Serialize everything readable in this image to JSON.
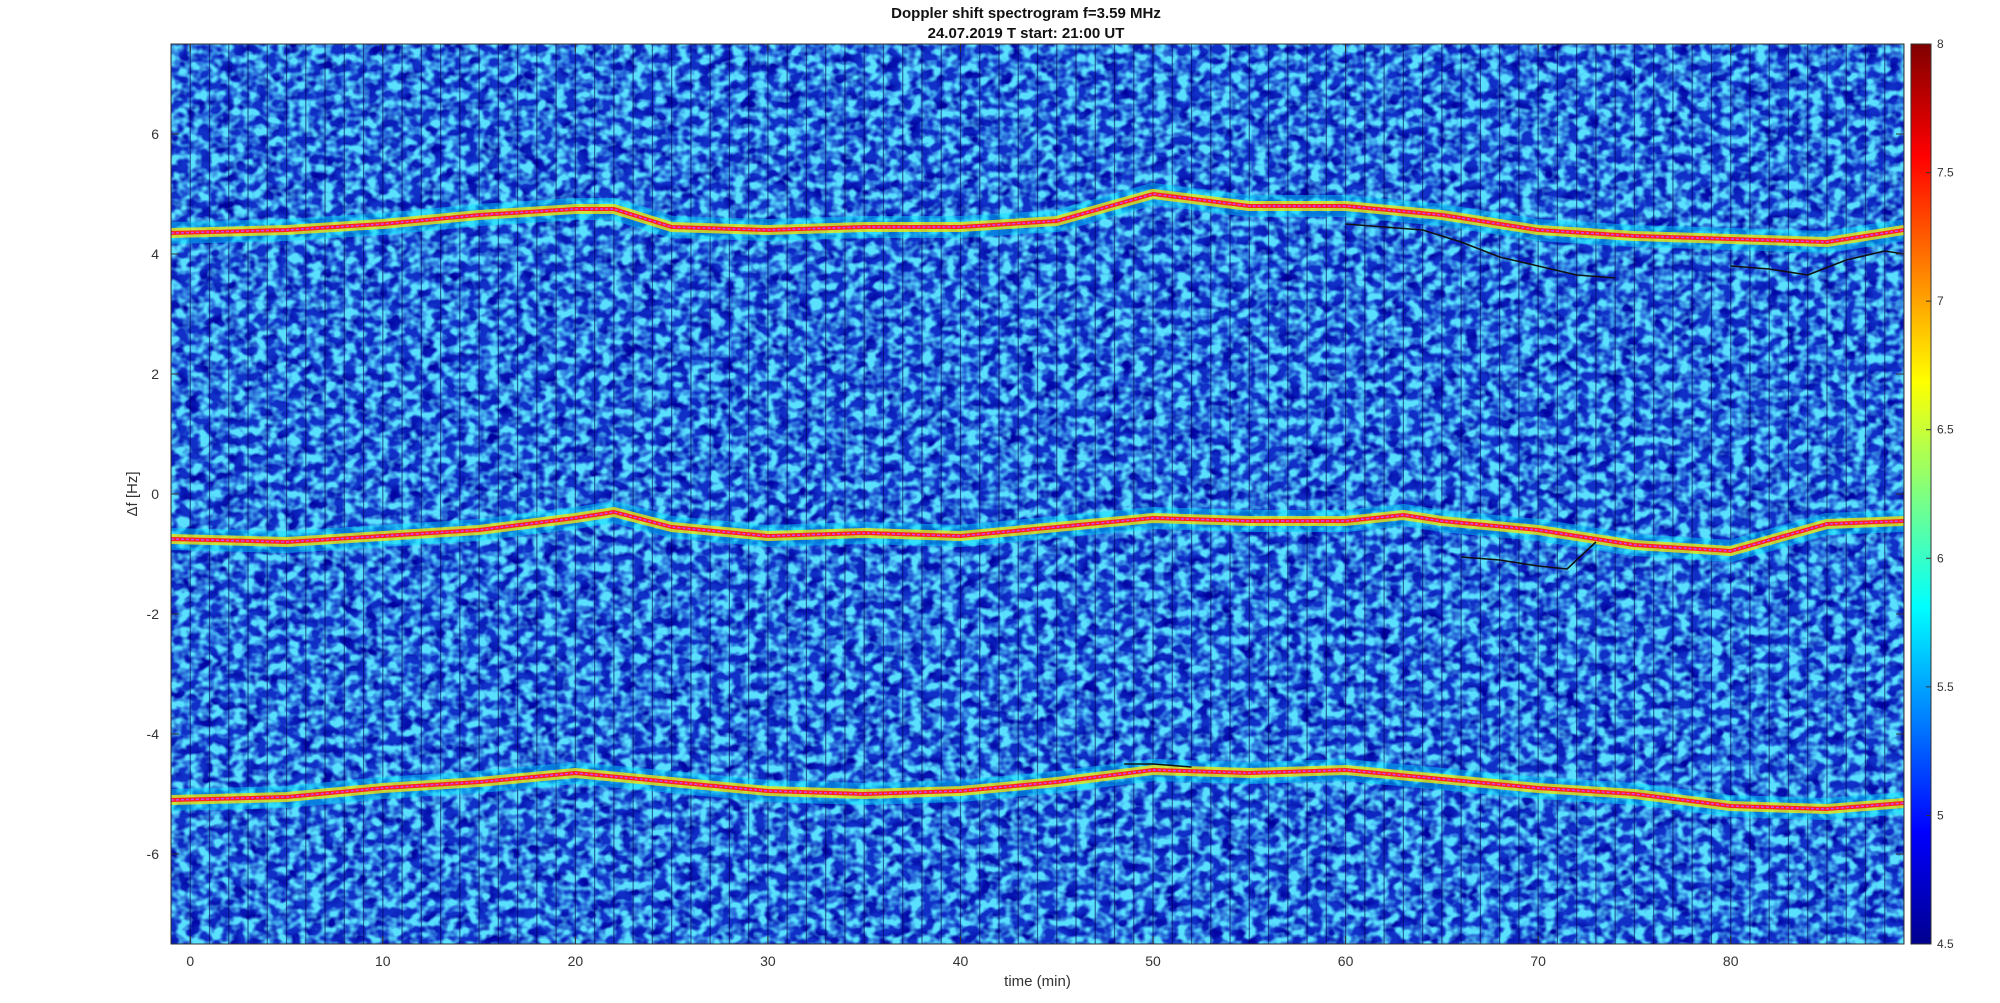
{
  "figure": {
    "title_line1": "Doppler shift spectrogram f=3.59 MHz",
    "title_line2": "24.07.2019   T start: 21:00 UT"
  },
  "chart_data": {
    "type": "heatmap",
    "title": "Doppler shift spectrogram f=3.59 MHz",
    "subtitle": "24.07.2019   T start: 21:00 UT",
    "xlabel": "time (min)",
    "ylabel": "Δf [Hz]",
    "xlim": [
      -1,
      89
    ],
    "ylim": [
      -7.5,
      7.5
    ],
    "x_ticks": [
      0,
      10,
      20,
      30,
      40,
      50,
      60,
      70,
      80
    ],
    "y_ticks": [
      -6,
      -4,
      -2,
      0,
      2,
      4,
      6
    ],
    "colorbar": {
      "colormap": "jet",
      "range": [
        4.5,
        8
      ],
      "ticks": [
        "4.5",
        "5",
        "5.5",
        "6",
        "6.5",
        "7",
        "7.5",
        "8"
      ]
    },
    "background_color": "#1030c8",
    "series": [
      {
        "color": "#ff2020",
        "x": [
          -1,
          5,
          10,
          15,
          20,
          22,
          25,
          30,
          35,
          40,
          45,
          50,
          55,
          60,
          65,
          70,
          75,
          80,
          85,
          89
        ],
        "values": [
          4.35,
          4.4,
          4.5,
          4.65,
          4.75,
          4.75,
          4.45,
          4.4,
          4.45,
          4.45,
          4.55,
          5.0,
          4.8,
          4.8,
          4.65,
          4.4,
          4.3,
          4.25,
          4.2,
          4.4
        ]
      },
      {
        "color": "#ff2020",
        "x": [
          -1,
          5,
          10,
          15,
          20,
          22,
          25,
          30,
          35,
          40,
          45,
          50,
          55,
          60,
          63,
          65,
          70,
          75,
          80,
          85,
          89
        ],
        "values": [
          -0.75,
          -0.8,
          -0.7,
          -0.6,
          -0.4,
          -0.3,
          -0.55,
          -0.7,
          -0.65,
          -0.7,
          -0.55,
          -0.4,
          -0.45,
          -0.45,
          -0.35,
          -0.45,
          -0.6,
          -0.85,
          -0.95,
          -0.5,
          -0.45
        ]
      },
      {
        "color": "#ff2020",
        "x": [
          -1,
          5,
          10,
          15,
          20,
          25,
          30,
          35,
          40,
          45,
          50,
          55,
          60,
          65,
          70,
          75,
          80,
          85,
          89
        ],
        "values": [
          -5.1,
          -5.05,
          -4.9,
          -4.8,
          -4.65,
          -4.8,
          -4.95,
          -5.0,
          -4.95,
          -4.8,
          -4.6,
          -4.65,
          -4.6,
          -4.75,
          -4.9,
          -5.0,
          -5.2,
          -5.25,
          -5.15
        ]
      },
      {
        "color": "#111111",
        "x": [
          60,
          62,
          64,
          66,
          68,
          70,
          72,
          74
        ],
        "values": [
          4.5,
          4.45,
          4.4,
          4.2,
          3.95,
          3.8,
          3.65,
          3.6
        ]
      },
      {
        "color": "#111111",
        "x": [
          80,
          82,
          84,
          86,
          88,
          89
        ],
        "values": [
          3.8,
          3.75,
          3.65,
          3.9,
          4.05,
          4.0
        ]
      },
      {
        "color": "#111111",
        "x": [
          66,
          68,
          70,
          71.5,
          73
        ],
        "values": [
          -1.05,
          -1.1,
          -1.2,
          -1.25,
          -0.8
        ]
      },
      {
        "color": "#111111",
        "x": [
          48.5,
          50,
          52
        ],
        "values": [
          -4.5,
          -4.5,
          -4.55
        ]
      }
    ]
  }
}
